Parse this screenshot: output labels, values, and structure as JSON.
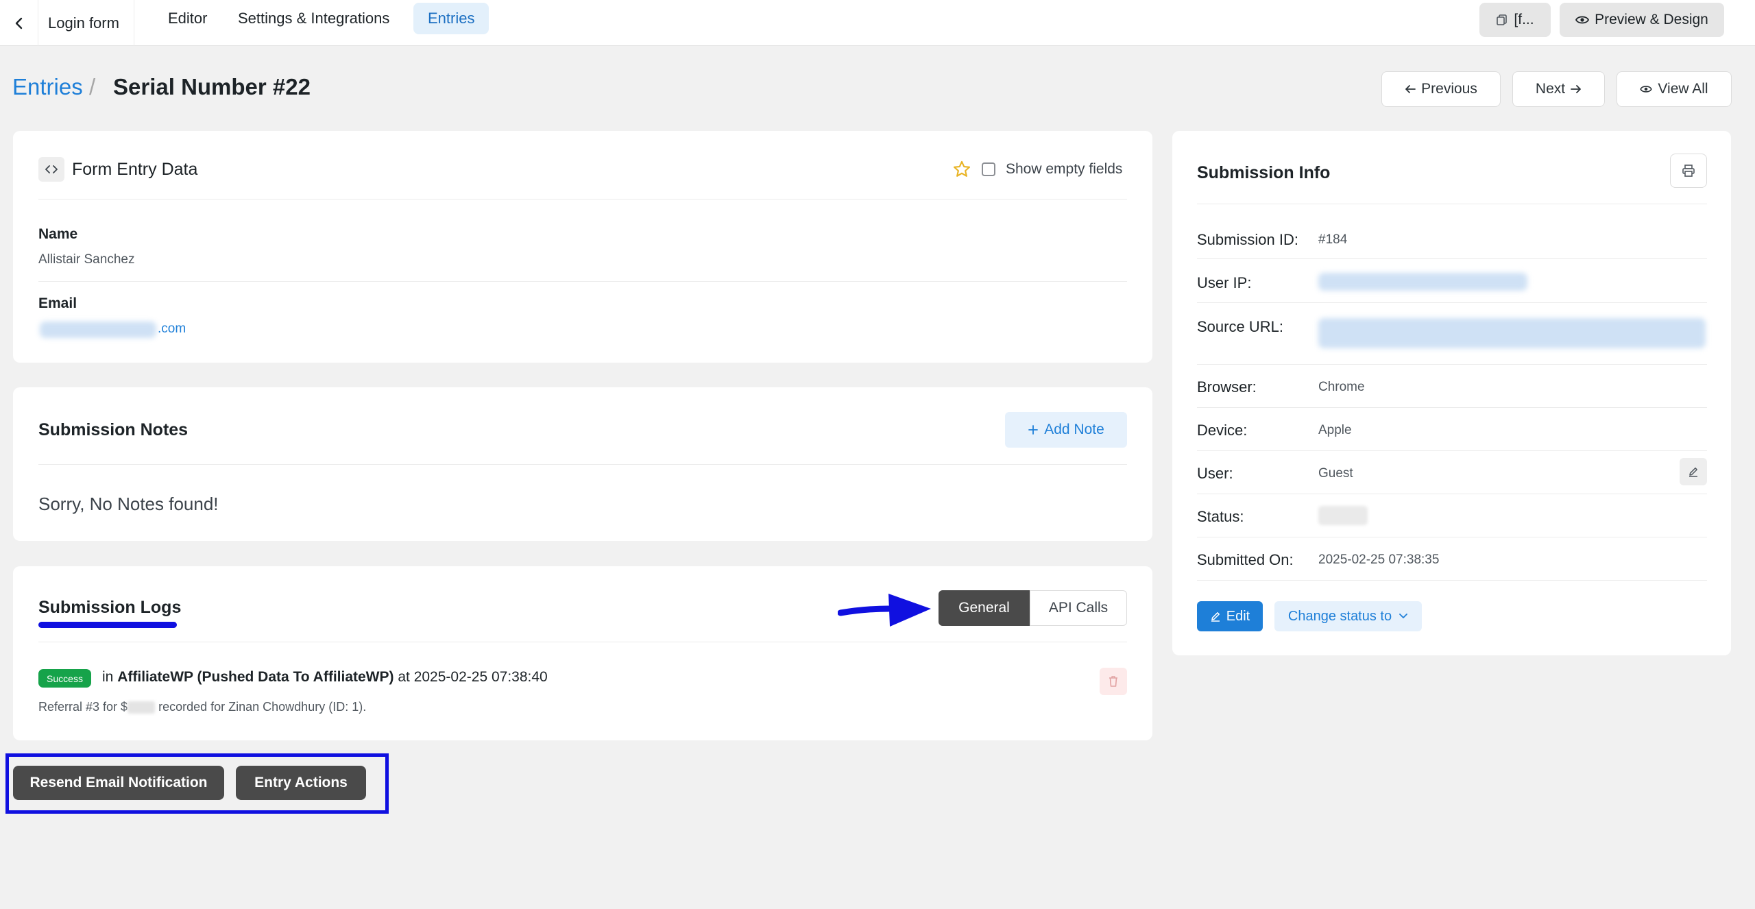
{
  "topbar": {
    "form_name": "Login form",
    "tabs": [
      {
        "label": "Editor"
      },
      {
        "label": "Settings & Integrations"
      },
      {
        "label": "Entries"
      }
    ],
    "shortcode_label": "[f...",
    "preview_label": "Preview & Design"
  },
  "header": {
    "breadcrumb_link": "Entries",
    "separator": "/",
    "title": "Serial Number #22",
    "previous_label": "Previous",
    "next_label": "Next",
    "view_all_label": "View All"
  },
  "entry_data": {
    "title": "Form Entry Data",
    "show_empty_label": "Show empty fields",
    "fields": [
      {
        "label": "Name",
        "value": "Allistair Sanchez"
      },
      {
        "label": "Email",
        "value_suffix": ".com"
      }
    ]
  },
  "notes": {
    "title": "Submission Notes",
    "add_note_label": "Add Note",
    "empty_text": "Sorry, No Notes found!"
  },
  "logs": {
    "title": "Submission Logs",
    "tab_general": "General",
    "tab_api": "API Calls",
    "entries": [
      {
        "status": "Success",
        "prefix": "in",
        "integration": "AffiliateWP (Pushed Data To AffiliateWP)",
        "at_word": "at",
        "timestamp": "2025-02-25 07:38:40",
        "note_prefix": "Referral #3 for $",
        "note_suffix": "recorded for Zinan Chowdhury (ID: 1)."
      }
    ]
  },
  "actions": {
    "resend_label": "Resend Email Notification",
    "entry_actions_label": "Entry Actions"
  },
  "info": {
    "title": "Submission Info",
    "rows": [
      {
        "label": "Submission ID:",
        "value": "#184"
      },
      {
        "label": "User IP:",
        "value": ""
      },
      {
        "label": "Source URL:",
        "value": ""
      },
      {
        "label": "Browser:",
        "value": "Chrome"
      },
      {
        "label": "Device:",
        "value": "Apple"
      },
      {
        "label": "User:",
        "value": "Guest"
      },
      {
        "label": "Status:",
        "value": ""
      },
      {
        "label": "Submitted On:",
        "value": "2025-02-25 07:38:35"
      }
    ],
    "edit_label": "Edit",
    "change_status_label": "Change status to"
  },
  "annotations": {
    "arrow_color": "#1010e0",
    "box_color": "#1010e0",
    "underline_color": "#1010e0"
  },
  "colors": {
    "accent": "#1e7fd8",
    "success": "#16a34a",
    "dark_button": "#4a4a4a",
    "background": "#f1f1f1"
  }
}
